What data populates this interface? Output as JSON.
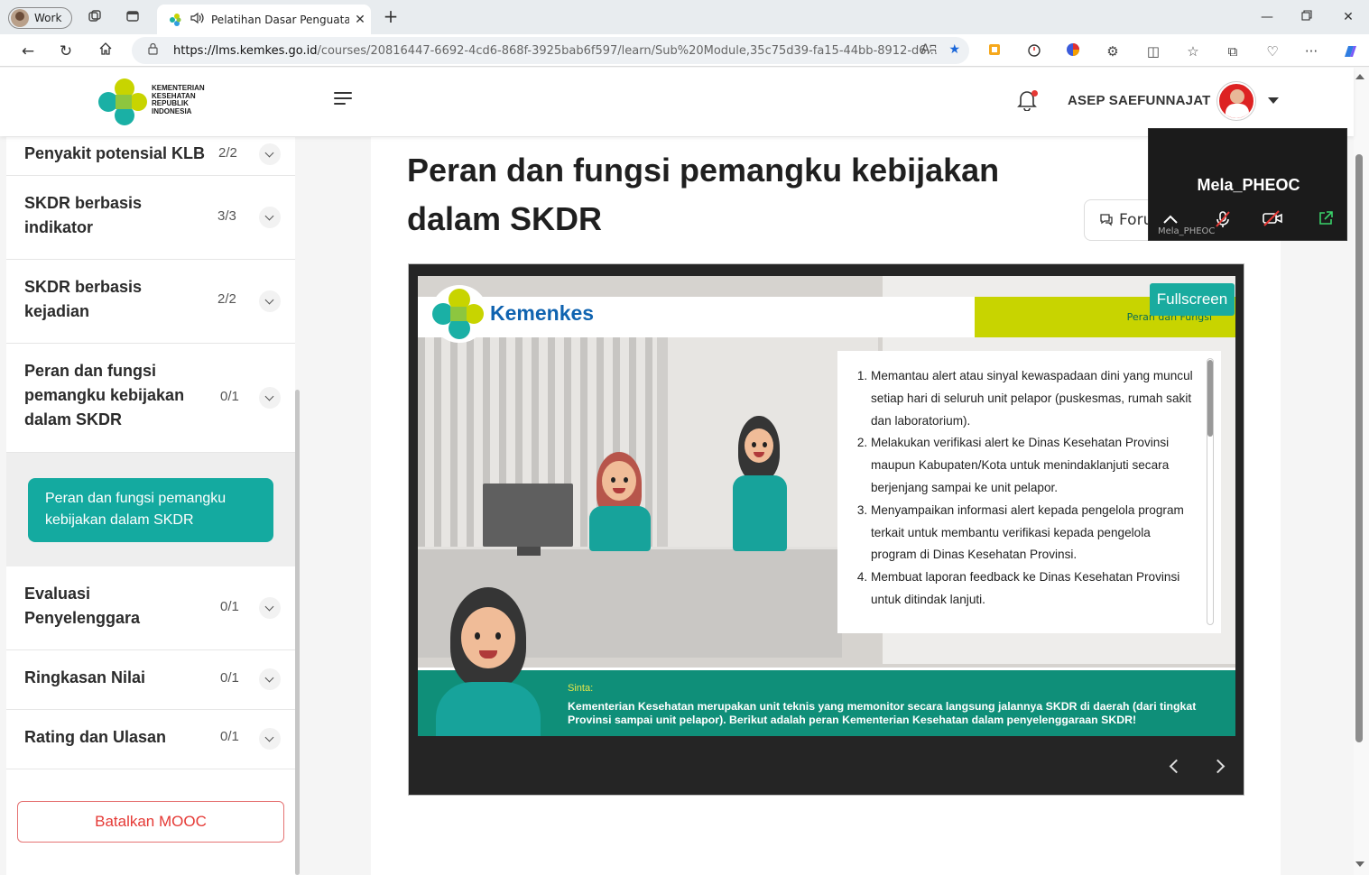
{
  "browser": {
    "profile_label": "Work",
    "tab_title": "Pelatihan Dasar Penguatan S",
    "url_host": "https://lms.kemkes.go.id",
    "url_path": "/courses/20816447-6692-4cd6-868f-3925bab6f597/learn/Sub%20Module,35c75d39-fa15-44bb-8912-d6...",
    "read_aloud_label": "Aʭ"
  },
  "header": {
    "logo_text": "KEMENTERIAN\nKESEHATAN\nREPUBLIK\nINDONESIA",
    "user_name": "ASEP SAEFUNNAJAT"
  },
  "sidebar": {
    "items": [
      {
        "title": "Penyakit potensial KLB",
        "count": "2/2"
      },
      {
        "title": "SKDR berbasis indikator",
        "count": "3/3"
      },
      {
        "title": "SKDR berbasis kejadian",
        "count": "2/2"
      },
      {
        "title": "Peran dan fungsi pemangku kebijakan dalam SKDR",
        "count": "0/1"
      },
      {
        "title": "Evaluasi Penyelenggara",
        "count": "0/1"
      },
      {
        "title": "Ringkasan Nilai",
        "count": "0/1"
      },
      {
        "title": "Rating dan Ulasan",
        "count": "0/1"
      }
    ],
    "active_lesson": "Peran dan fungsi pemangku kebijakan dalam SKDR",
    "cancel_button": "Batalkan MOOC"
  },
  "main": {
    "title": "Peran dan fungsi pemangku kebijakan dalam SKDR",
    "forum_button": "Forum"
  },
  "slide": {
    "brand": "Kemenkes",
    "section_label": "Peran dan Fungsi",
    "fullscreen_button": "Fullscreen",
    "list": [
      "Memantau alert atau sinyal kewaspadaan dini yang muncul setiap hari di seluruh unit pelapor (puskesmas, rumah sakit dan laboratorium).",
      "Melakukan verifikasi alert ke Dinas Kesehatan Provinsi maupun Kabupaten/Kota untuk menindaklanjuti secara berjenjang sampai ke unit pelapor.",
      "Menyampaikan informasi alert kepada pengelola program terkait untuk membantu verifikasi kepada pengelola program di Dinas Kesehatan Provinsi.",
      "Membuat laporan feedback ke Dinas Kesehatan Provinsi untuk ditindak lanjuti."
    ],
    "speaker": "Sinta:",
    "dialog": "Kementerian Kesehatan merupakan unit teknis yang memonitor secara langsung jalannya SKDR di daerah (dari tingkat Provinsi sampai unit pelapor). Berikut adalah peran Kementerian Kesehatan dalam penyelenggaraan SKDR!"
  },
  "call": {
    "participant": "Mela_PHEOC",
    "sub_label": "Mela_PHEOC"
  },
  "colors": {
    "teal": "#14aaa0",
    "lime": "#c8d400",
    "danger": "#e53935",
    "brand_blue": "#0f63b0"
  }
}
